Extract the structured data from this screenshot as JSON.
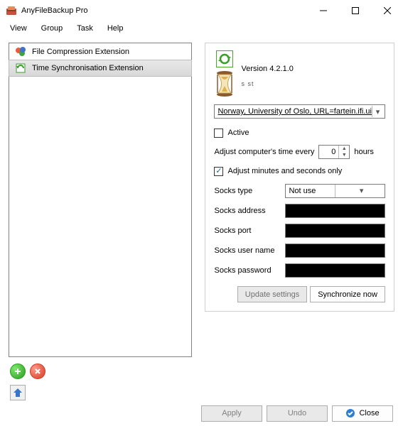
{
  "window": {
    "title": "AnyFileBackup Pro"
  },
  "menu": {
    "view": "View",
    "group": "Group",
    "task": "Task",
    "help": "Help"
  },
  "list": {
    "items": [
      {
        "label": "File Compression Extension"
      },
      {
        "label": "Time Synchronisation Extension"
      }
    ]
  },
  "details": {
    "version_label": "Version 4.2.1.0",
    "watermark": "s st",
    "server_selected": "Norway, University of Oslo, URL=fartein.ifi.ui",
    "active_label": "Active",
    "adjust_every_label": "Adjust computer's time every",
    "adjust_every_value": "0",
    "adjust_every_unit": "hours",
    "adjust_minutes_label": "Adjust minutes and seconds only",
    "socks_type_label": "Socks type",
    "socks_type_value": "Not use",
    "socks_address_label": "Socks address",
    "socks_port_label": "Socks port",
    "socks_user_label": "Socks user name",
    "socks_pass_label": "Socks password",
    "update_btn": "Update settings",
    "sync_btn": "Synchronize now"
  },
  "footer": {
    "apply": "Apply",
    "undo": "Undo",
    "close": "Close"
  }
}
